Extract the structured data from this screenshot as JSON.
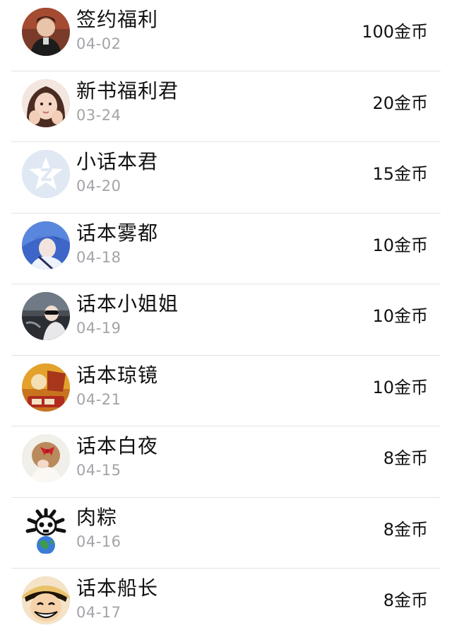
{
  "list": {
    "items": [
      {
        "name": "签约福利",
        "date": "04-02",
        "reward": "100金币",
        "avatar": "avatar-man-dark-bg"
      },
      {
        "name": "新书福利君",
        "date": "03-24",
        "reward": "20金币",
        "avatar": "avatar-girl-photo"
      },
      {
        "name": "小话本君",
        "date": "04-20",
        "reward": "15金币",
        "avatar": "avatar-z-logo"
      },
      {
        "name": "话本雾都",
        "date": "04-18",
        "reward": "10金币",
        "avatar": "avatar-anime-blue"
      },
      {
        "name": "话本小姐姐",
        "date": "04-19",
        "reward": "10金币",
        "avatar": "avatar-car-photo"
      },
      {
        "name": "话本琼镜",
        "date": "04-21",
        "reward": "10金币",
        "avatar": "avatar-琼镜-logo"
      },
      {
        "name": "话本白夜",
        "date": "04-15",
        "reward": "8金币",
        "avatar": "avatar-girl-red-bow"
      },
      {
        "name": "肉粽",
        "date": "04-16",
        "reward": "8金币",
        "avatar": "avatar-skull-globe"
      },
      {
        "name": "话本船长",
        "date": "04-17",
        "reward": "8金币",
        "avatar": "avatar-luffy"
      }
    ]
  },
  "colors": {
    "title": "#111111",
    "date": "#a3a3a8",
    "separator": "#e3e3e6"
  }
}
